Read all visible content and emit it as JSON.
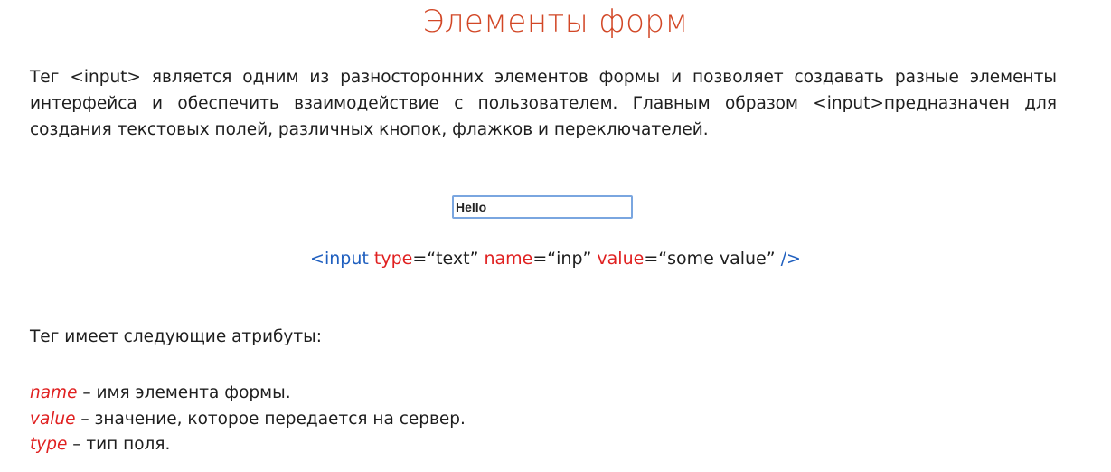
{
  "title": "Элементы форм",
  "intro": "Тег <input> является одним из разносторонних элементов формы и позволяет создавать разные элементы интерфейса и обеспечить взаимодействие с пользователем. Главным образом <input>предназначен для создания текстовых полей, различных кнопок, флажков и переключателей.",
  "demo_input": {
    "value": "Hello"
  },
  "code": {
    "open": "<input",
    "attr_type": "type",
    "val_type": "=“text”",
    "attr_name": "name",
    "val_name": "=“inp”",
    "attr_value": "value",
    "val_value": "=“some value”",
    "close": "/>"
  },
  "attrs_heading": "Тег имеет следующие атрибуты:",
  "attributes": [
    {
      "name": "name",
      "desc": " – имя элемента формы."
    },
    {
      "name": "value",
      "desc": " – значение, которое передается на сервер."
    },
    {
      "name": "type",
      "desc": " – тип поля."
    }
  ],
  "colors": {
    "title": "#d24726",
    "tag": "#1f5fbf",
    "attribute": "#e02020",
    "input_border": "#7aa6e0"
  }
}
